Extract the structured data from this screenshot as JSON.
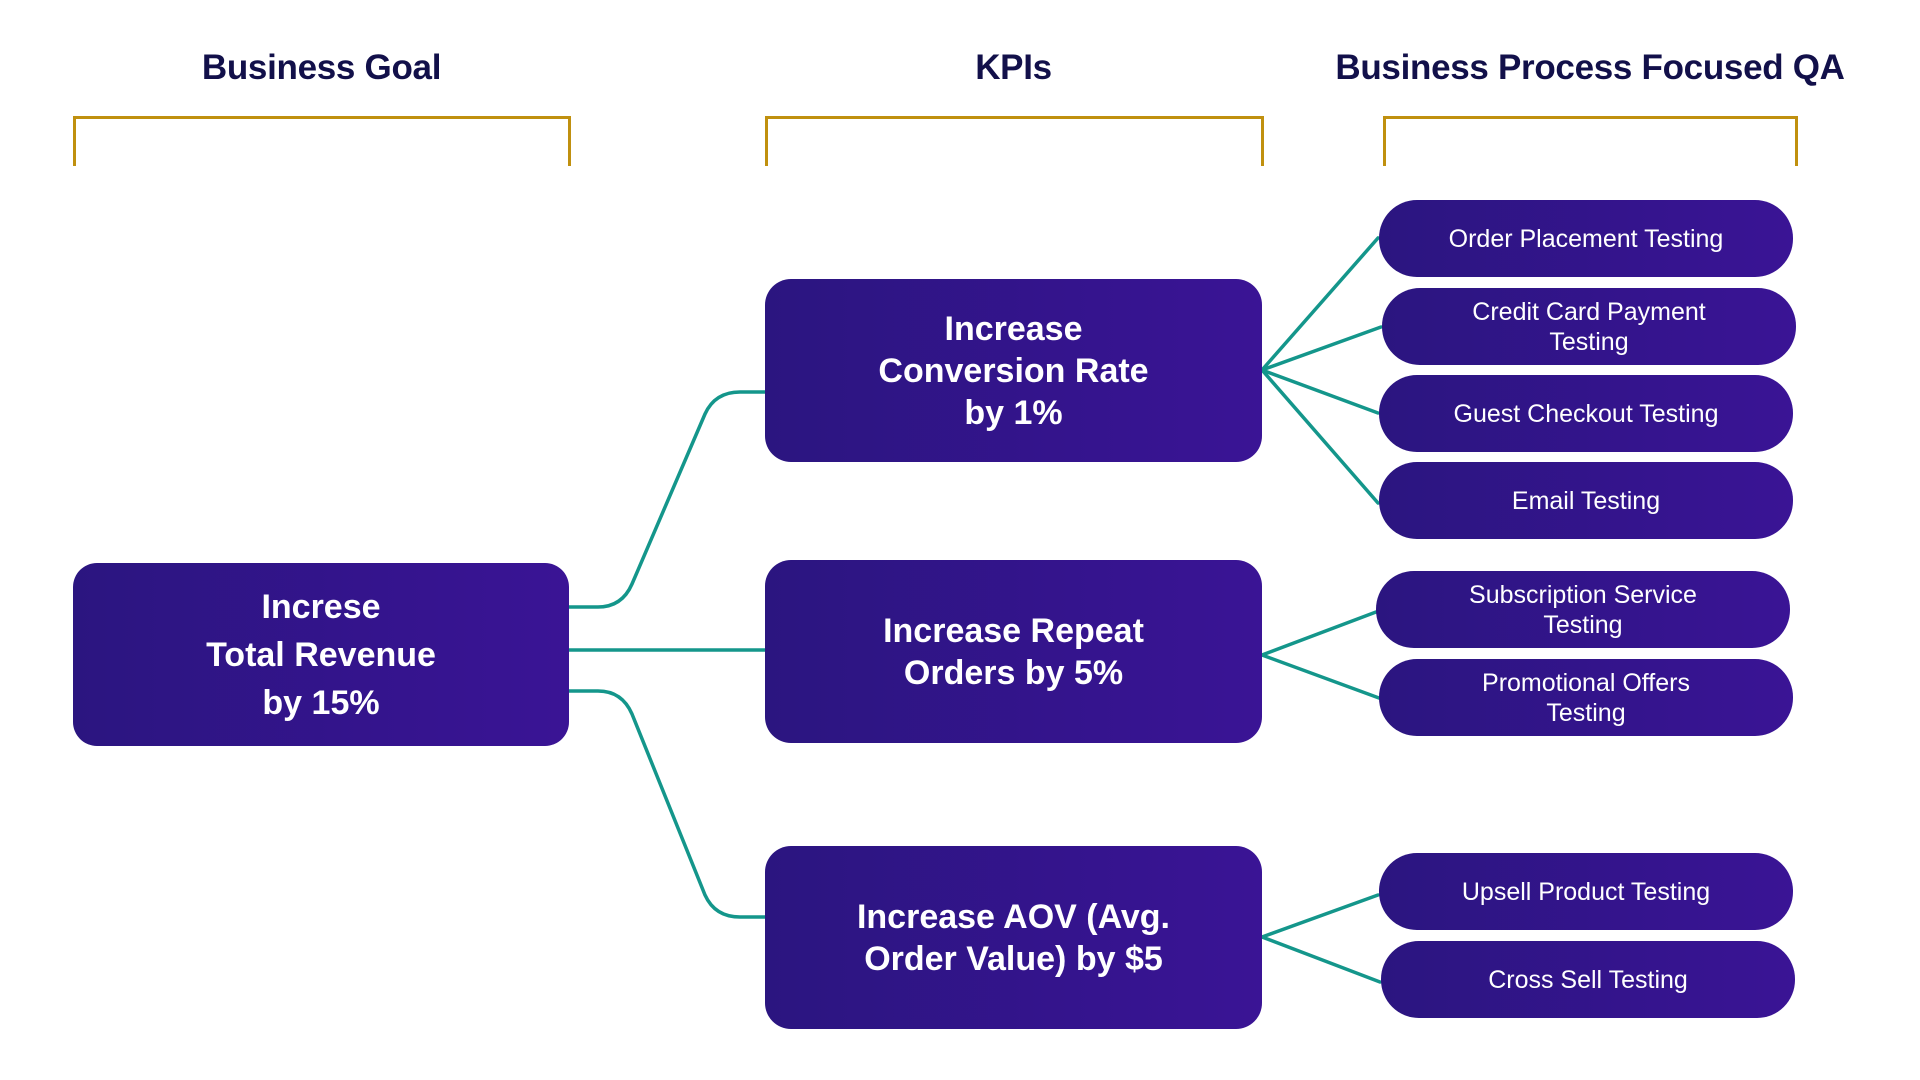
{
  "columns": {
    "goal": {
      "header": "Business Goal"
    },
    "kpis": {
      "header": "KPIs"
    },
    "qa": {
      "header": "Business Process Focused QA"
    }
  },
  "goal": {
    "label": "Increse\nTotal Revenue\nby 15%"
  },
  "kpis": [
    {
      "label": "Increase\nConversion Rate\nby 1%",
      "qa": [
        "Order Placement Testing",
        "Credit Card Payment\nTesting",
        "Guest Checkout Testing",
        "Email Testing"
      ]
    },
    {
      "label": "Increase Repeat\nOrders by 5%",
      "qa": [
        "Subscription Service\nTesting",
        "Promotional Offers\nTesting"
      ]
    },
    {
      "label": "Increase AOV (Avg.\nOrder Value) by $5",
      "qa": [
        "Upsell Product Testing",
        "Cross Sell Testing"
      ]
    }
  ],
  "colors": {
    "box_start": "#2b1580",
    "box_end": "#3a1495",
    "connector": "#14968b",
    "bracket": "#c0900f",
    "header_text": "#12104a"
  }
}
